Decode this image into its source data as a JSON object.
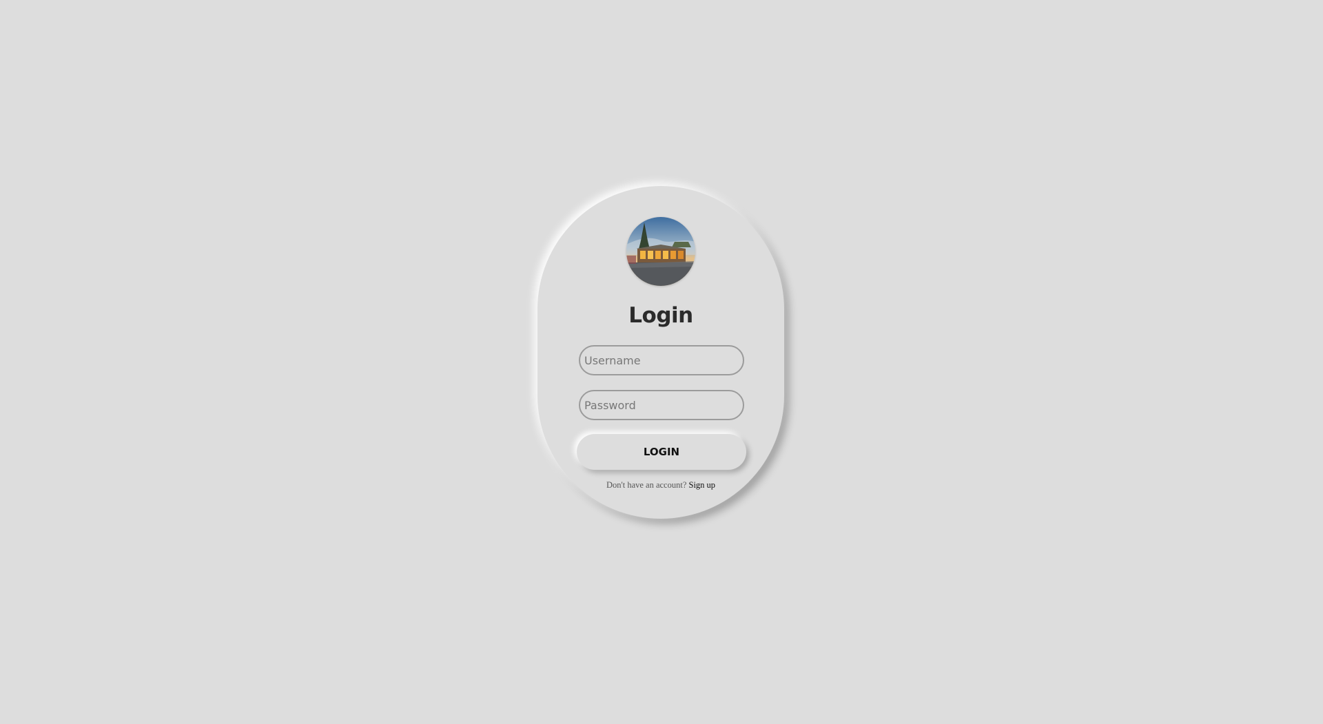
{
  "login_card": {
    "title": "Login",
    "username": {
      "placeholder": "Username",
      "value": ""
    },
    "password": {
      "placeholder": "Password",
      "value": ""
    },
    "login_button": "LOGIN",
    "signup_prompt": "Don't have an account?",
    "signup_link": "Sign up",
    "avatar_icon": "house-photo-avatar"
  },
  "colors": {
    "background": "#dddddd",
    "title": "#2b2b2b",
    "input_border": "#9b9b9b"
  }
}
